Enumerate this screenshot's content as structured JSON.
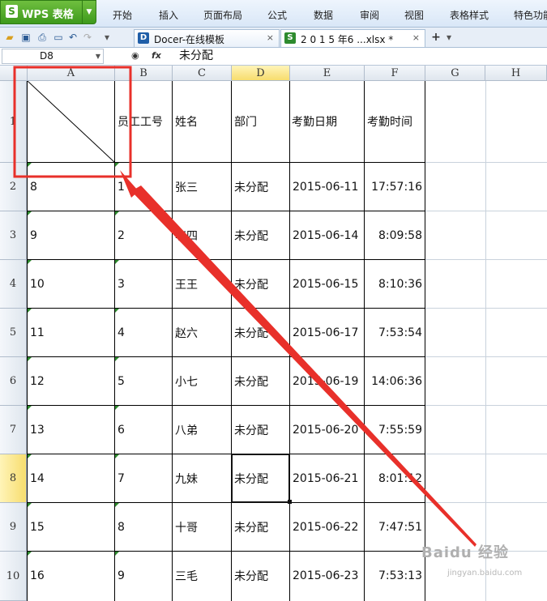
{
  "app": {
    "logo": "S",
    "name": "WPS 表格"
  },
  "menu": [
    "开始",
    "插入",
    "页面布局",
    "公式",
    "数据",
    "审阅",
    "视图",
    "表格样式",
    "特色功能"
  ],
  "doc_tabs": [
    {
      "label": "Docer-在线模板",
      "icon_text": "D",
      "close": "×"
    },
    {
      "label": "2 0 1 5 年6 ...xlsx *",
      "icon_text": "S",
      "close": "×"
    }
  ],
  "new_tab": "+",
  "formula_bar": {
    "name_box": "D8",
    "fx": "fx",
    "value": "未分配"
  },
  "columns": [
    "A",
    "B",
    "C",
    "D",
    "E",
    "F",
    "G",
    "H"
  ],
  "rows": [
    "1",
    "2",
    "3",
    "4",
    "5",
    "6",
    "7",
    "8",
    "9",
    "10"
  ],
  "header_row": [
    "",
    "员工工号",
    "姓名",
    "部门",
    "考勤日期",
    "考勤时间"
  ],
  "data_rows": [
    [
      "8",
      "1",
      "张三",
      "未分配",
      "2015-06-11",
      "17:57:16"
    ],
    [
      "9",
      "2",
      "李四",
      "未分配",
      "2015-06-14",
      "8:09:58"
    ],
    [
      "10",
      "3",
      "王王",
      "未分配",
      "2015-06-15",
      "8:10:36"
    ],
    [
      "11",
      "4",
      "赵六",
      "未分配",
      "2015-06-17",
      "7:53:54"
    ],
    [
      "12",
      "5",
      "小七",
      "未分配",
      "2015-06-19",
      "14:06:36"
    ],
    [
      "13",
      "6",
      "八弟",
      "未分配",
      "2015-06-20",
      "7:55:59"
    ],
    [
      "14",
      "7",
      "九妹",
      "未分配",
      "2015-06-21",
      "8:01:12"
    ],
    [
      "15",
      "8",
      "十哥",
      "未分配",
      "2015-06-22",
      "7:47:51"
    ],
    [
      "16",
      "9",
      "三毛",
      "未分配",
      "2015-06-23",
      "7:53:13"
    ]
  ],
  "selected_cell": "D8",
  "annotation_color": "#e8302a",
  "watermark": {
    "text": "Baidu 经验",
    "sub": "jingyan.baidu.com"
  }
}
